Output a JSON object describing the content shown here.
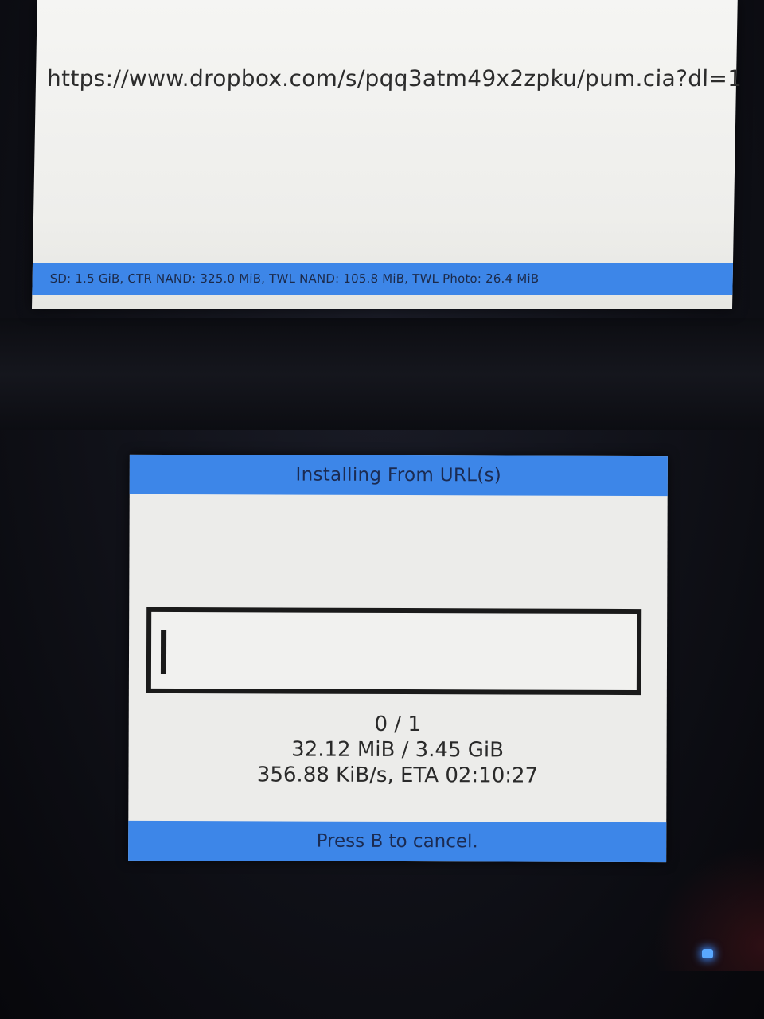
{
  "top_screen": {
    "url": "https://www.dropbox.com/s/pqq3atm49x2zpku/pum.cia?dl=1",
    "status_bar": "SD: 1.5 GiB, CTR NAND: 325.0 MiB, TWL NAND: 105.8 MiB, TWL Photo: 26.4 MiB"
  },
  "bottom_screen": {
    "title": "Installing From URL(s)",
    "progress": {
      "fraction": 0.0093
    },
    "item_count": "0 / 1",
    "size_progress": "32.12 MiB / 3.45 GiB",
    "speed_eta": "356.88 KiB/s, ETA 02:10:27",
    "footer": "Press B to cancel."
  },
  "colors": {
    "accent_bar": "#3d86e8",
    "screen_bg": "#ececea",
    "text": "#2a2a2a",
    "led": "#5aa8ff"
  }
}
